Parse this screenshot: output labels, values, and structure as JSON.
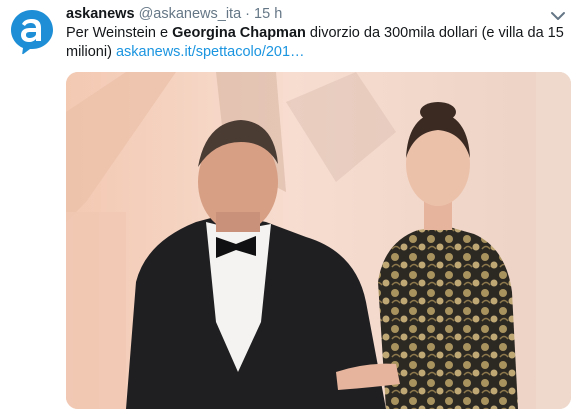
{
  "tweet": {
    "display_name": "askanews",
    "handle": "@askanews_ita",
    "separator": "·",
    "time": "15 h",
    "text_before": "Per Weinstein e ",
    "text_bold": "Georgina Chapman",
    "text_after": " divorzio da 300mila dollari (e villa da 15 milioni) ",
    "link": "askanews.it/spettacolo/201…"
  },
  "colors": {
    "brand_blue": "#1b95e0",
    "avatar_blue": "#1e8fd6",
    "muted": "#657786"
  },
  "icons": {
    "avatar": "askanews-logo-icon",
    "menu": "chevron-down-icon"
  }
}
